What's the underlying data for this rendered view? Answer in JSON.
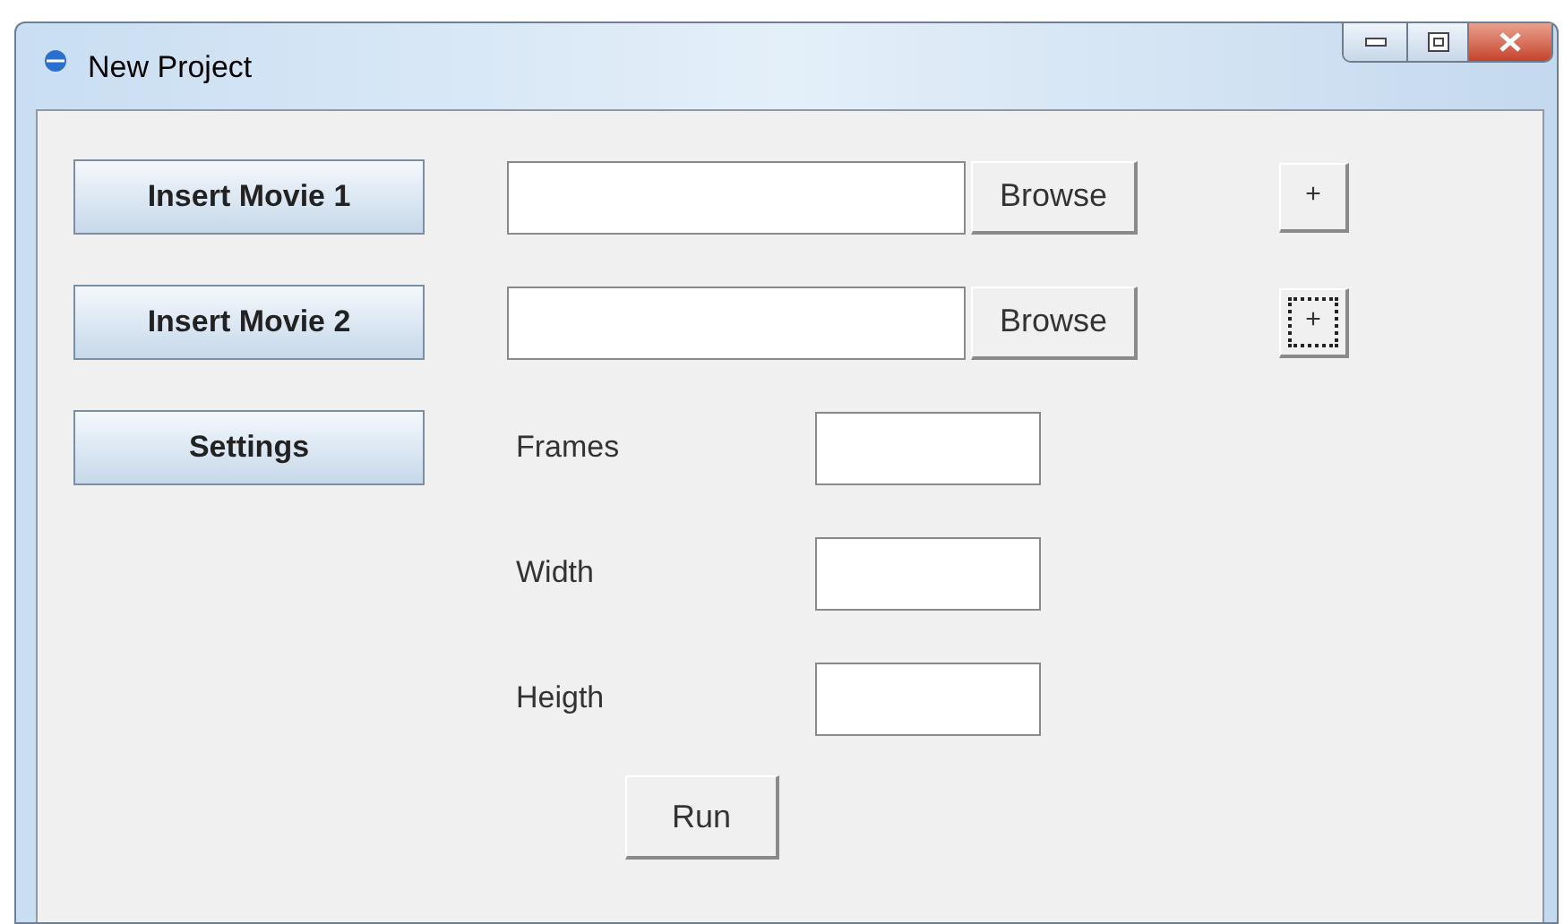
{
  "window": {
    "title": "New Project"
  },
  "movie_rows": [
    {
      "button": "Insert Movie 1",
      "browse": "Browse",
      "add": "+",
      "focused": false
    },
    {
      "button": "Insert Movie 2",
      "browse": "Browse",
      "add": "+",
      "focused": true
    }
  ],
  "settings_button": "Settings",
  "settings": [
    {
      "label": "Frames"
    },
    {
      "label": "Width"
    },
    {
      "label": "Heigth"
    }
  ],
  "run_button": "Run"
}
